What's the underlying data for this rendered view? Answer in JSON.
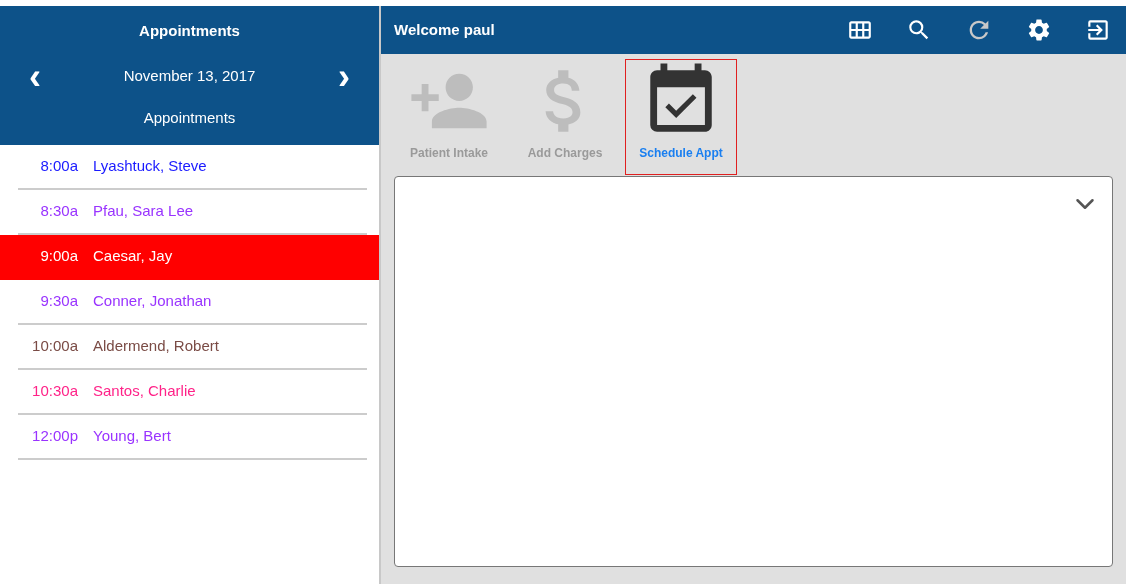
{
  "sidebar": {
    "title": "Appointments",
    "date": "November 13, 2017",
    "prev": "‹",
    "next": "›",
    "subtitle": "Appointments",
    "appointments": [
      {
        "time": "8:00a",
        "name": "Lyashtuck, Steve",
        "color": "#1a1aff",
        "selected": false
      },
      {
        "time": "8:30a",
        "name": "Pfau, Sara Lee",
        "color": "#9933ff",
        "selected": false
      },
      {
        "time": "9:00a",
        "name": "Caesar, Jay",
        "selected": true
      },
      {
        "time": "9:30a",
        "name": "Conner, Jonathan",
        "color": "#9933ff",
        "selected": false
      },
      {
        "time": "10:00a",
        "name": "Aldermend, Robert",
        "color": "#7a4b45",
        "selected": false
      },
      {
        "time": "10:30a",
        "name": "Santos, Charlie",
        "color": "#ff2288",
        "selected": false
      },
      {
        "time": "12:00p",
        "name": "Young, Bert",
        "color": "#9933ff",
        "selected": false
      }
    ]
  },
  "header": {
    "welcome": "Welcome paul"
  },
  "toolbar": [
    {
      "kind": "patient",
      "label": "Patient Intake",
      "disabled": true,
      "selected": false
    },
    {
      "kind": "charges",
      "label": "Add Charges",
      "disabled": true,
      "selected": false
    },
    {
      "kind": "schedule",
      "label": "Schedule Appt",
      "disabled": false,
      "selected": true
    }
  ]
}
